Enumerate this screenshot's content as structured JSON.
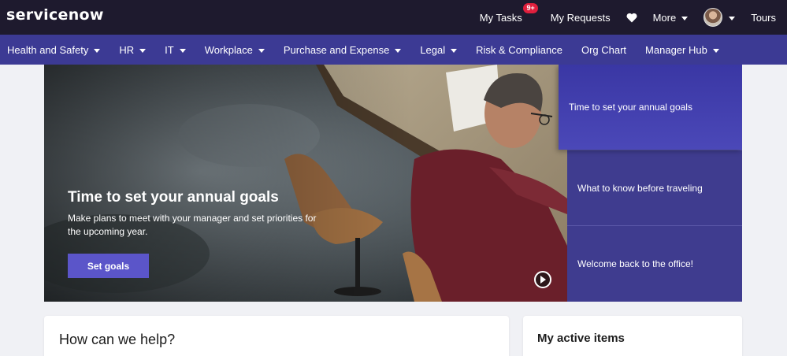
{
  "brand": {
    "logo_text": "servicenow"
  },
  "topbar": {
    "my_tasks": "My Tasks",
    "tasks_badge": "9+",
    "my_requests": "My Requests",
    "more": "More",
    "tours": "Tours",
    "icons": {
      "favorites": "heart-icon",
      "profile": "avatar"
    }
  },
  "nav": {
    "items": [
      {
        "label": "Health and Safety",
        "dropdown": true
      },
      {
        "label": "HR",
        "dropdown": true
      },
      {
        "label": "IT",
        "dropdown": true
      },
      {
        "label": "Workplace",
        "dropdown": true
      },
      {
        "label": "Purchase and Expense",
        "dropdown": true
      },
      {
        "label": "Legal",
        "dropdown": true
      },
      {
        "label": "Risk & Compliance",
        "dropdown": false
      },
      {
        "label": "Org Chart",
        "dropdown": false
      },
      {
        "label": "Manager Hub",
        "dropdown": true
      }
    ]
  },
  "hero": {
    "title": "Time to set your annual goals",
    "description": "Make plans to meet with your manager and set priorities for the upcoming year.",
    "button": "Set goals",
    "tabs": [
      {
        "label": "Time to set your annual goals",
        "active": true
      },
      {
        "label": "What to know before traveling",
        "active": false
      },
      {
        "label": "Welcome back to the office!",
        "active": false
      }
    ]
  },
  "cards": {
    "help_title": "How can we help?",
    "active_items_title": "My active items"
  },
  "colors": {
    "topbar_bg": "#1e1a2e",
    "nav_bg": "#3c3a94",
    "accent_button": "#5b55c9",
    "badge": "#e01f3d"
  }
}
